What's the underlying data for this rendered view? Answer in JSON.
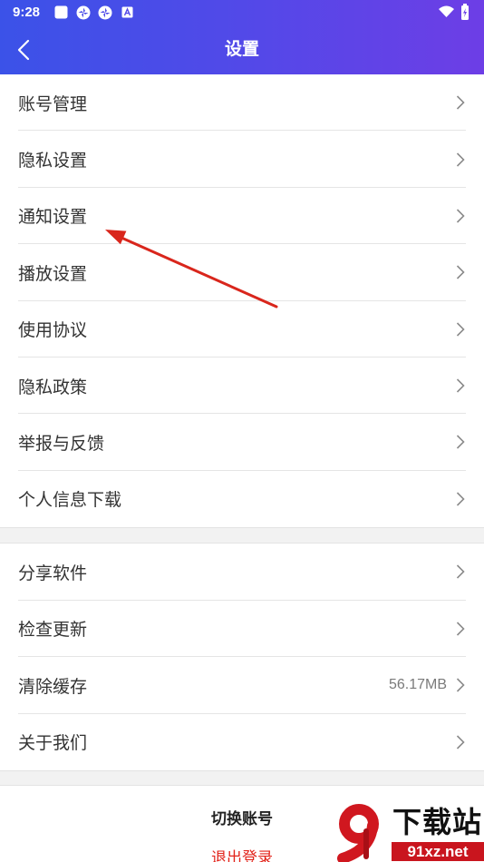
{
  "status_bar": {
    "time": "9:28",
    "left_icons": [
      "square-notification-icon",
      "pinwheel-app-icon",
      "pinwheel-app-icon",
      "a-letter-icon"
    ],
    "right_icons": [
      "wifi-icon",
      "battery-charging-icon"
    ]
  },
  "header": {
    "title": "设置",
    "back_icon": "chevron-left-icon"
  },
  "groups": [
    {
      "items": [
        {
          "label": "账号管理"
        },
        {
          "label": "隐私设置"
        },
        {
          "label": "通知设置"
        },
        {
          "label": "播放设置"
        },
        {
          "label": "使用协议"
        },
        {
          "label": "隐私政策"
        },
        {
          "label": "举报与反馈"
        },
        {
          "label": "个人信息下载"
        }
      ]
    },
    {
      "items": [
        {
          "label": "分享软件"
        },
        {
          "label": "检查更新"
        },
        {
          "label": "清除缓存",
          "value": "56.17MB"
        },
        {
          "label": "关于我们"
        }
      ]
    }
  ],
  "row_icon": "chevron-right-icon",
  "actions": {
    "switch_account": "切换账号",
    "logout": "退出登录"
  },
  "watermark": {
    "logo_text": "91",
    "brand": "下载站",
    "site": "91xz.net"
  },
  "colors": {
    "header_gradient_start": "#3b52e8",
    "header_gradient_end": "#6d3ee6",
    "logout_text": "#e2241b",
    "annotation_arrow": "#d9261c",
    "watermark_red": "#c9151e"
  }
}
